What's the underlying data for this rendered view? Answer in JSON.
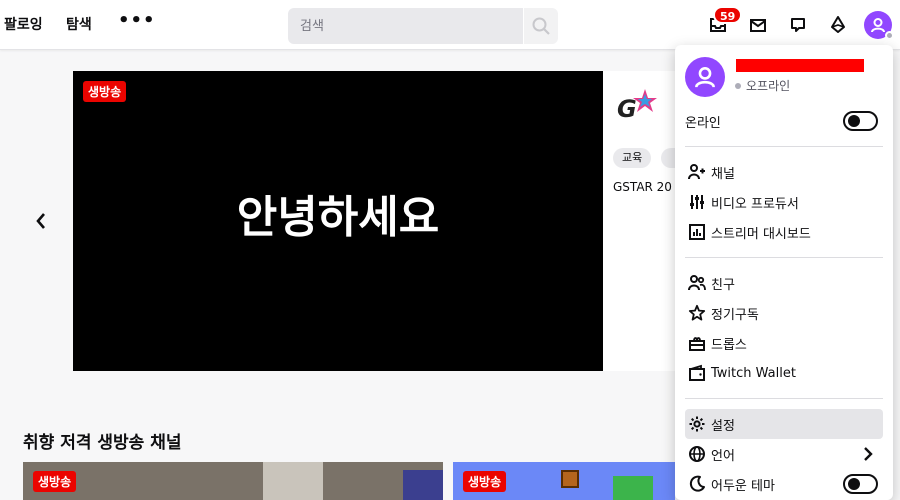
{
  "nav": {
    "following": "팔로잉",
    "browse": "탐색",
    "more": "•••"
  },
  "search": {
    "placeholder": "검색"
  },
  "notifications": {
    "count": "59"
  },
  "hero": {
    "live_label": "생방송",
    "overlay_text": "안녕하세요",
    "tags": [
      "교육"
    ],
    "side_title": "GSTAR 20"
  },
  "section": {
    "title": "취향 저격 생방송 채널"
  },
  "thumbnails": [
    {
      "live_label": "생방송"
    },
    {
      "live_label": "생방송"
    }
  ],
  "user_menu": {
    "status": "오프라인",
    "online_label": "온라인",
    "online_enabled": false,
    "group1": [
      {
        "label": "채널",
        "icon": "user-channel-icon"
      },
      {
        "label": "비디오 프로듀서",
        "icon": "sliders-icon"
      },
      {
        "label": "스트리머 대시보드",
        "icon": "dashboard-icon"
      }
    ],
    "group2": [
      {
        "label": "친구",
        "icon": "friends-icon"
      },
      {
        "label": "정기구독",
        "icon": "star-icon"
      },
      {
        "label": "드롭스",
        "icon": "drops-icon"
      },
      {
        "label": "Twitch Wallet",
        "icon": "wallet-icon"
      }
    ],
    "group3": [
      {
        "label": "설정",
        "icon": "gear-icon"
      },
      {
        "label": "언어",
        "icon": "globe-icon"
      },
      {
        "label": "어두운 테마",
        "icon": "moon-icon"
      }
    ],
    "dark_theme_enabled": false
  },
  "colors": {
    "brand": "#9147ff",
    "live": "#eb0400",
    "redaction": "#ff0000"
  }
}
